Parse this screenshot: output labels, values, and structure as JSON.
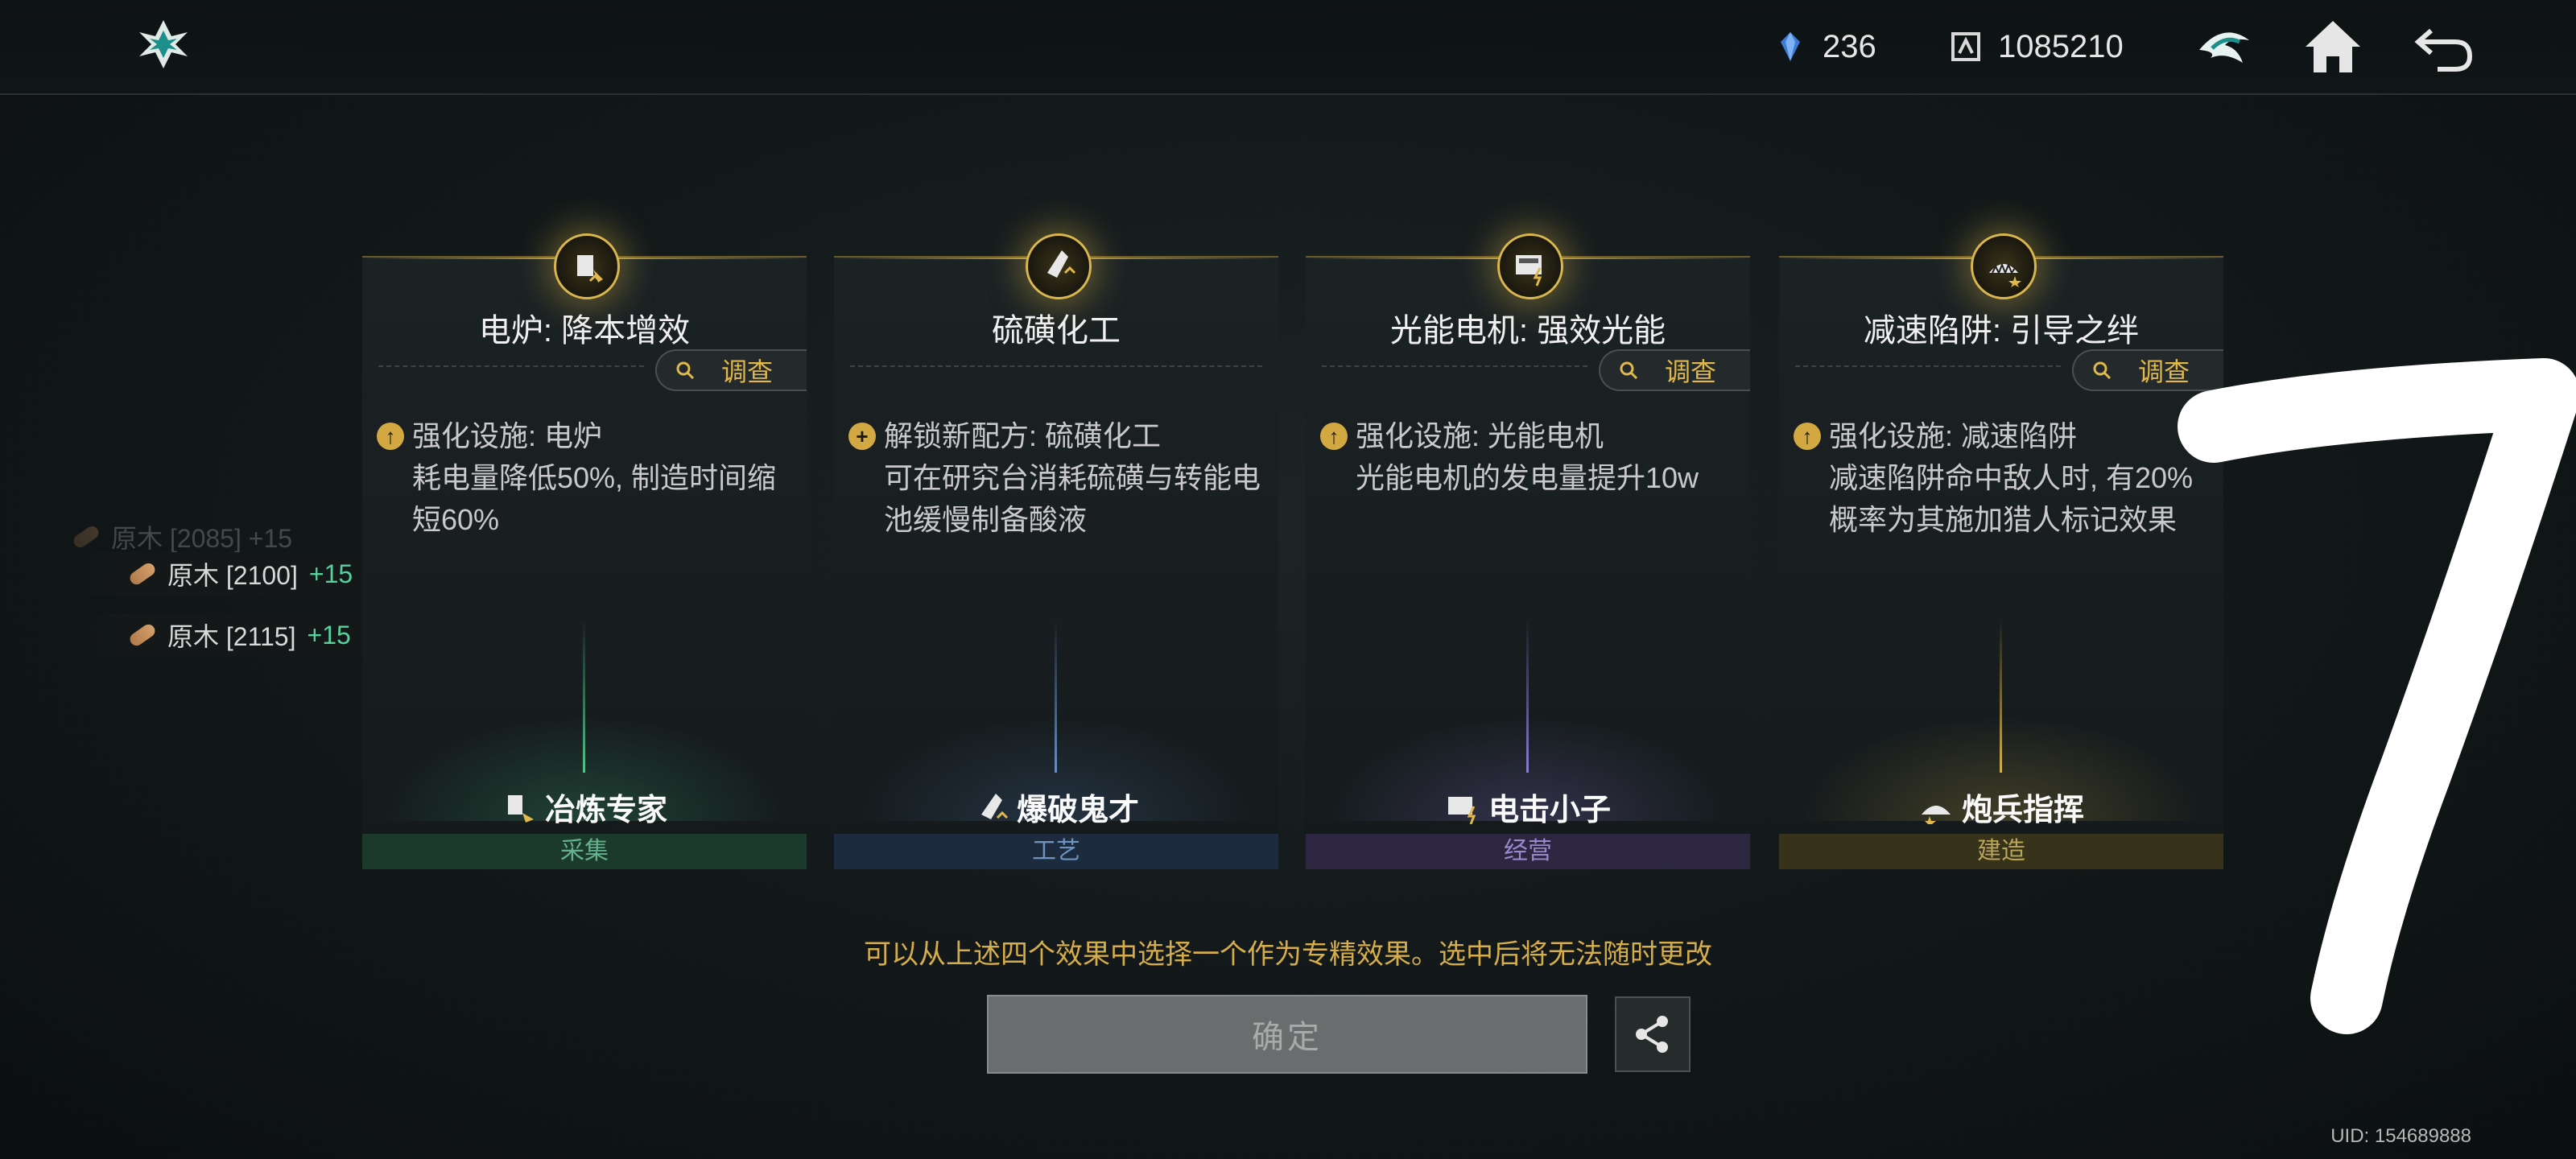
{
  "header": {
    "resource1": {
      "icon": "crystal-icon",
      "value": "236"
    },
    "resource2": {
      "icon": "currency-icon",
      "value": "1085210"
    },
    "icons": [
      "guild-icon",
      "home-icon",
      "back-icon"
    ]
  },
  "left_list": {
    "faded": "原木 [2085] +15",
    "items": [
      {
        "name": "原木 [2100]",
        "bonus": "+15"
      },
      {
        "name": "原木 [2115]",
        "bonus": "+15"
      }
    ]
  },
  "investigate_label": "调查",
  "cards": [
    {
      "title": "电炉: 降本增效",
      "desc_line1": "强化设施: 电炉",
      "desc_rest": "耗电量降低50%, 制造时间缩短60%",
      "bullet": "up",
      "role": "冶炼专家",
      "category": "采集"
    },
    {
      "title": "硫磺化工",
      "desc_line1": "解锁新配方: 硫磺化工",
      "desc_rest": "可在研究台消耗硫磺与转能电池缓慢制备酸液",
      "bullet": "plus",
      "role": "爆破鬼才",
      "category": "工艺"
    },
    {
      "title": "光能电机: 强效光能",
      "desc_line1": "强化设施: 光能电机",
      "desc_rest": "光能电机的发电量提升10w",
      "bullet": "up",
      "role": "电击小子",
      "category": "经营"
    },
    {
      "title": "减速陷阱: 引导之绊",
      "desc_line1": "强化设施: 减速陷阱",
      "desc_rest": "减速陷阱命中敌人时, 有20%概率为其施加猎人标记效果",
      "bullet": "up",
      "role": "炮兵指挥",
      "category": "建造"
    }
  ],
  "hint": "可以从上述四个效果中选择一个作为专精效果。选中后将无法随时更改",
  "confirm_label": "确定",
  "uid": "UID: 154689888",
  "colors": {
    "accent_gold": "#d6ad4b",
    "plus_green": "#57d19a"
  }
}
